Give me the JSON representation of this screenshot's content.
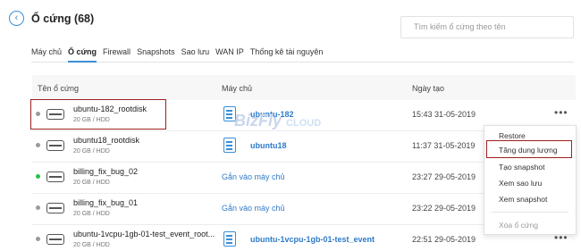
{
  "header": {
    "back_icon": "arrow-left-icon",
    "title": "Ổ cứng (68)"
  },
  "search": {
    "placeholder": "Tìm kiếm ổ cứng theo tên"
  },
  "tabs": [
    {
      "label": "Máy chủ"
    },
    {
      "label": "Ổ cứng",
      "active": true
    },
    {
      "label": "Firewall"
    },
    {
      "label": "Snapshots"
    },
    {
      "label": "Sao lưu"
    },
    {
      "label": "WAN IP"
    },
    {
      "label": "Thống kê tài nguyên"
    }
  ],
  "table": {
    "columns": [
      "Tên ổ cứng",
      "Máy chủ",
      "Ngày tạo"
    ],
    "rows": [
      {
        "name": "ubuntu-182_rootdisk",
        "size": "20 GB / HDD",
        "server": "ubuntu-182",
        "date": "15:43 31-05-2019",
        "status_color": "#9a9a9a"
      },
      {
        "name": "ubuntu18_rootdisk",
        "size": "20 GB / HDD",
        "server": "ubuntu18",
        "date": "11:37 31-05-2019",
        "status_color": "#9a9a9a"
      },
      {
        "name": "billing_fix_bug_02",
        "size": "20 GB / HDD",
        "server": "Gắn vào máy chủ",
        "date": "23:27 29-05-2019",
        "status_color": "#27c24c"
      },
      {
        "name": "billing_fix_bug_01",
        "size": "20 GB / HDD",
        "server": "Gắn vào máy chủ",
        "date": "23:22 29-05-2019",
        "status_color": "#9a9a9a"
      },
      {
        "name": "ubuntu-1vcpu-1gb-01-test_event_root...",
        "size": "20 GB / HDD",
        "server": "ubuntu-1vcpu-1gb-01-test_event",
        "date": "22:51 29-05-2019",
        "status_color": "#9a9a9a"
      }
    ]
  },
  "watermark": {
    "brand": "BizFly",
    "suffix": "CLOUD"
  },
  "context_menu": {
    "items": [
      {
        "label": "Restore"
      },
      {
        "label": "Tăng dung lượng"
      },
      {
        "label": "Tạo snapshot"
      },
      {
        "label": "Xem sao lưu"
      },
      {
        "label": "Xem snapshot"
      },
      {
        "label": "Xóa ổ cứng",
        "disabled": true
      }
    ]
  },
  "colors": {
    "accent": "#3a8fd6",
    "link": "#2f7bc9",
    "highlight_border": "#9e1f1f"
  }
}
